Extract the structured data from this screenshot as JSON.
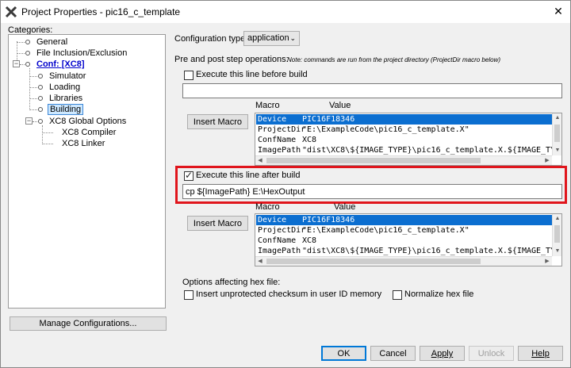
{
  "window": {
    "title": "Project Properties - pic16_c_template",
    "close_glyph": "✕"
  },
  "categories": {
    "label": "Categories:",
    "items": [
      {
        "label": "General"
      },
      {
        "label": "File Inclusion/Exclusion"
      },
      {
        "label": "Conf: [XC8]"
      },
      {
        "label": "Simulator"
      },
      {
        "label": "Loading"
      },
      {
        "label": "Libraries"
      },
      {
        "label": "Building"
      },
      {
        "label": "XC8 Global Options"
      },
      {
        "label": "XC8 Compiler"
      },
      {
        "label": "XC8 Linker"
      }
    ],
    "manage_button": "Manage Configurations..."
  },
  "config": {
    "type_label": "Configuration type:",
    "type_value": "application"
  },
  "prepost": {
    "label": "Pre and post step operations:",
    "note": "Note: commands are run from the project directory (ProjectDir macro below)"
  },
  "pre_build": {
    "checkbox_label": "Execute this line before build",
    "checked": false,
    "command": "",
    "insert_macro": "Insert Macro",
    "col_macro": "Macro",
    "col_value": "Value",
    "rows": [
      {
        "macro": "Device",
        "value": "PIC16F18346"
      },
      {
        "macro": "ProjectDir",
        "value": "\"E:\\ExampleCode\\pic16_c_template.X\""
      },
      {
        "macro": "ConfName",
        "value": "XC8"
      },
      {
        "macro": "ImagePath",
        "value": "\"dist\\XC8\\${IMAGE_TYPE}\\pic16_c_template.X.${IMAGE_TYPE}"
      }
    ]
  },
  "post_build": {
    "checkbox_label": "Execute this line after build",
    "checked": true,
    "command": "cp ${ImagePath} E:\\HexOutput",
    "insert_macro": "Insert Macro",
    "col_macro": "Macro",
    "col_value": "Value",
    "rows": [
      {
        "macro": "Device",
        "value": "PIC16F18346"
      },
      {
        "macro": "ProjectDir",
        "value": "\"E:\\ExampleCode\\pic16_c_template.X\""
      },
      {
        "macro": "ConfName",
        "value": "XC8"
      },
      {
        "macro": "ImagePath",
        "value": "\"dist\\XC8\\${IMAGE_TYPE}\\pic16_c_template.X.${IMAGE_TYPE}"
      }
    ]
  },
  "hex_options": {
    "label": "Options affecting hex file:",
    "checksum_label": "Insert unprotected checksum in user ID memory",
    "checksum_checked": false,
    "normalize_label": "Normalize hex file",
    "normalize_checked": false
  },
  "footer": {
    "ok": "OK",
    "cancel": "Cancel",
    "apply": "Apply",
    "unlock": "Unlock",
    "help": "Help"
  },
  "colors": {
    "selection": "#0b6ed0",
    "highlight": "#e0151c",
    "link": "#0000cc"
  }
}
